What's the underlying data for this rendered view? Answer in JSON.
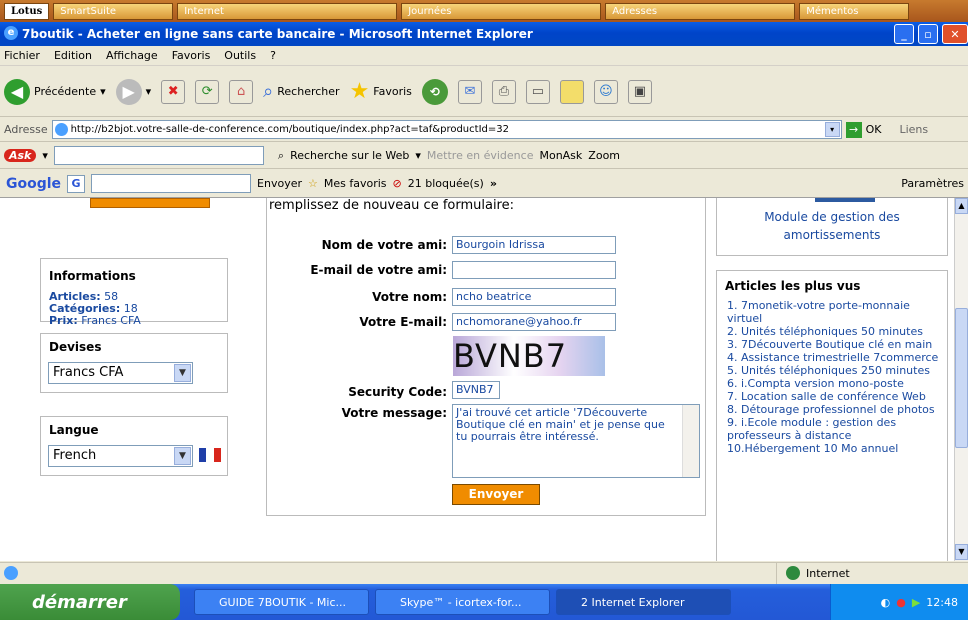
{
  "lotus_bar": {
    "main": "Lotus",
    "items": [
      "SmartSuite",
      "Internet",
      "Journées",
      "Adresses",
      "Mémentos"
    ]
  },
  "window": {
    "title": "7boutik - Acheter en ligne sans carte bancaire - Microsoft Internet Explorer"
  },
  "menu": [
    "Fichier",
    "Edition",
    "Affichage",
    "Favoris",
    "Outils",
    "?"
  ],
  "toolbar": {
    "back": "Précédente",
    "search": "Rechercher",
    "favorites": "Favoris"
  },
  "address": {
    "label": "Adresse",
    "url": "http://b2bjot.votre-salle-de-conference.com/boutique/index.php?act=taf&productId=32",
    "go": "OK",
    "links": "Liens"
  },
  "ask": {
    "search_web": "Recherche sur le Web",
    "highlight": "Mettre en évidence",
    "myask": "MonAsk",
    "zoom": "Zoom"
  },
  "google": {
    "label": "Google",
    "send": "Envoyer",
    "favorites": "Mes favoris",
    "blocked": "21 bloquée(s)",
    "settings": "Paramètres"
  },
  "sidebar": {
    "info_title": "Informations",
    "articles_label": "Articles:",
    "articles_value": "58",
    "categories_label": "Catégories:",
    "categories_value": "18",
    "price_label": "Prix:",
    "price_value": "Francs CFA",
    "currency_title": "Devises",
    "currency_value": "Francs CFA",
    "language_title": "Langue",
    "language_value": "French"
  },
  "form": {
    "intro": "remplissez de nouveau ce formulaire:",
    "friend_name_label": "Nom de votre ami:",
    "friend_name_value": "Bourgoin Idrissa",
    "friend_email_label": "E-mail de votre ami:",
    "friend_email_value": "",
    "your_name_label": "Votre nom:",
    "your_name_value": "ncho beatrice",
    "your_email_label": "Votre E-mail:",
    "your_email_value": "nchomorane@yahoo.fr",
    "captcha_text": "BVNB7",
    "security_label": "Security Code:",
    "security_value": "BVNB7",
    "message_label": "Votre message:",
    "message_value": "J'ai trouvé cet article '7Découverte Boutique clé en main' et je pense que tu pourrais être intéressé.",
    "submit": "Envoyer"
  },
  "right": {
    "module_text": "Module de gestion des amortissements",
    "top_title": "Articles les plus vus",
    "articles": [
      "1. 7monetik-votre porte-monnaie virtuel",
      "2. Unités téléphoniques 50 minutes",
      "3. 7Découverte Boutique clé en main",
      "4. Assistance trimestrielle 7commerce",
      "5. Unités téléphoniques 250 minutes",
      "6. i.Compta version mono-poste",
      "7. Location salle de conférence Web",
      "8. Détourage professionnel de photos",
      "9. i.Ecole module : gestion des professeurs à distance",
      "10.Hébergement 10 Mo annuel"
    ]
  },
  "status": {
    "zone": "Internet"
  },
  "taskbar": {
    "start": "démarrer",
    "tasks": [
      "GUIDE 7BOUTIK - Mic...",
      "Skype™ - icortex-for...",
      "2 Internet Explorer"
    ],
    "clock": "12:48"
  },
  "colors": {
    "accent_orange": "#f08c00",
    "link_blue": "#1a4aa0",
    "xp_blue": "#0a5de6"
  }
}
